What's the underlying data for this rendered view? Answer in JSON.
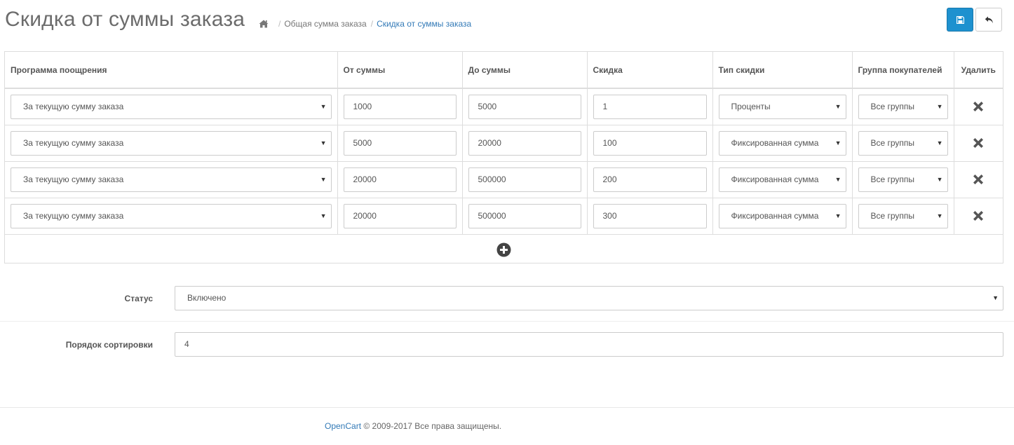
{
  "header": {
    "title": "Скидка от суммы заказа",
    "breadcrumb": [
      {
        "label": "Общая сумма заказа"
      },
      {
        "label": "Скидка от суммы заказа"
      }
    ],
    "icons": {
      "home": "home-icon",
      "save": "save-icon",
      "back": "reply-icon"
    },
    "colors": {
      "primary": "#1e91cf",
      "link": "#337ab7"
    }
  },
  "table": {
    "headers": {
      "program": "Программа поощрения",
      "from": "От суммы",
      "to": "До суммы",
      "discount": "Скидка",
      "type": "Тип скидки",
      "group": "Группа покупателей",
      "delete": "Удалить"
    },
    "rows": [
      {
        "program": "За текущую сумму заказа",
        "from": "1000",
        "to": "5000",
        "discount": "1",
        "type": "Проценты",
        "group": "Все группы"
      },
      {
        "program": "За текущую сумму заказа",
        "from": "5000",
        "to": "20000",
        "discount": "100",
        "type": "Фиксированная сумма",
        "group": "Все группы"
      },
      {
        "program": "За текущую сумму заказа",
        "from": "20000",
        "to": "500000",
        "discount": "200",
        "type": "Фиксированная сумма",
        "group": "Все группы"
      },
      {
        "program": "За текущую сумму заказа",
        "from": "20000",
        "to": "500000",
        "discount": "300",
        "type": "Фиксированная сумма",
        "group": "Все группы"
      }
    ]
  },
  "form": {
    "status": {
      "label": "Статус",
      "value": "Включено"
    },
    "sort_order": {
      "label": "Порядок сортировки",
      "value": "4"
    }
  },
  "footer": {
    "brand": "OpenCart",
    "text": " © 2009-2017 Все права защищены."
  }
}
